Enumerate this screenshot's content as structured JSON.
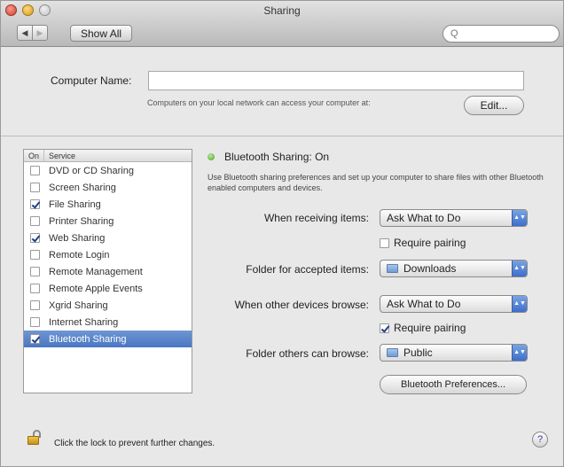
{
  "window": {
    "title": "Sharing"
  },
  "toolbar": {
    "back": "◀",
    "forward": "▶",
    "show_all": "Show All",
    "search_icon": "Q",
    "search_placeholder": ""
  },
  "computer_name": {
    "label": "Computer Name:",
    "value": "",
    "note": "Computers on your local network can access your computer at:",
    "edit_label": "Edit..."
  },
  "services": {
    "header_on": "On",
    "header_service": "Service",
    "items": [
      {
        "label": "DVD or CD Sharing",
        "on": false
      },
      {
        "label": "Screen Sharing",
        "on": false
      },
      {
        "label": "File Sharing",
        "on": true
      },
      {
        "label": "Printer Sharing",
        "on": false
      },
      {
        "label": "Web Sharing",
        "on": true
      },
      {
        "label": "Remote Login",
        "on": false
      },
      {
        "label": "Remote Management",
        "on": false
      },
      {
        "label": "Remote Apple Events",
        "on": false
      },
      {
        "label": "Xgrid Sharing",
        "on": false
      },
      {
        "label": "Internet Sharing",
        "on": false
      },
      {
        "label": "Bluetooth Sharing",
        "on": true,
        "selected": true
      }
    ]
  },
  "detail": {
    "status": "Bluetooth Sharing: On",
    "status_color": "#4aa42a",
    "description": "Use Bluetooth sharing preferences and set up your computer to share files with other Bluetooth enabled computers and devices.",
    "receiving_label": "When receiving items:",
    "receiving_value": "Ask What to Do",
    "require_pairing_1": {
      "label": "Require pairing",
      "checked": false
    },
    "accepted_folder_label": "Folder for accepted items:",
    "accepted_folder_value": "Downloads",
    "browse_label": "When other devices browse:",
    "browse_value": "Ask What to Do",
    "require_pairing_2": {
      "label": "Require pairing",
      "checked": true
    },
    "browse_folder_label": "Folder others can browse:",
    "browse_folder_value": "Public",
    "bt_prefs_label": "Bluetooth Preferences..."
  },
  "footer": {
    "lock_text": "Click the lock to prevent further changes.",
    "help": "?"
  },
  "colors": {
    "selection": "#4a76c2",
    "accent": "#3c6fcc"
  }
}
